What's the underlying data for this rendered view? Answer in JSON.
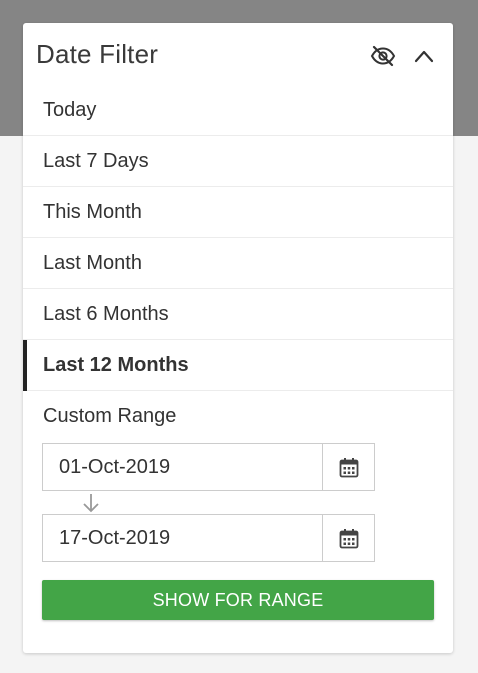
{
  "filter": {
    "title": "Date Filter",
    "icons": {
      "visibility": "eye-off-icon",
      "collapse": "chevron-up-icon",
      "calendar": "calendar-icon",
      "range_arrow": "arrow-down-icon"
    },
    "options": [
      {
        "label": "Today",
        "selected": false
      },
      {
        "label": "Last 7 Days",
        "selected": false
      },
      {
        "label": "This Month",
        "selected": false
      },
      {
        "label": "Last Month",
        "selected": false
      },
      {
        "label": "Last 6 Months",
        "selected": false
      },
      {
        "label": "Last 12 Months",
        "selected": true
      }
    ],
    "custom_range": {
      "label": "Custom Range",
      "from_value": "01-Oct-2019",
      "to_value": "17-Oct-2019",
      "button_label": "SHOW FOR RANGE"
    }
  },
  "colors": {
    "accent_button": "#43a547",
    "selected_marker": "#222222",
    "backdrop_band": "#858585"
  }
}
